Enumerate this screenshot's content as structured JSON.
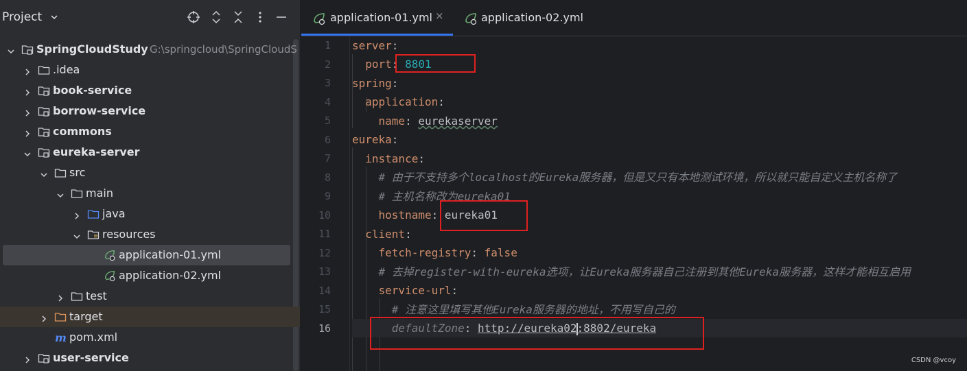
{
  "project_panel": {
    "title": "Project",
    "tree": [
      {
        "label": "SpringCloudStudy",
        "path": "G:\\springcloud\\SpringCloudS",
        "level": 0,
        "arrow": "down",
        "icon": "module-folder",
        "bold": true
      },
      {
        "label": ".idea",
        "level": 1,
        "arrow": "right",
        "icon": "folder"
      },
      {
        "label": "book-service",
        "level": 1,
        "arrow": "right",
        "icon": "module-folder",
        "bold": true
      },
      {
        "label": "borrow-service",
        "level": 1,
        "arrow": "right",
        "icon": "module-folder",
        "bold": true
      },
      {
        "label": "commons",
        "level": 1,
        "arrow": "right",
        "icon": "module-folder",
        "bold": true
      },
      {
        "label": "eureka-server",
        "level": 1,
        "arrow": "down",
        "icon": "module-folder",
        "bold": true
      },
      {
        "label": "src",
        "level": 2,
        "arrow": "down",
        "icon": "folder"
      },
      {
        "label": "main",
        "level": 3,
        "arrow": "down",
        "icon": "folder"
      },
      {
        "label": "java",
        "level": 4,
        "arrow": "right",
        "icon": "source-folder"
      },
      {
        "label": "resources",
        "level": 4,
        "arrow": "down",
        "icon": "resources-folder"
      },
      {
        "label": "application-01.yml",
        "level": 5,
        "arrow": "",
        "icon": "spring-yml",
        "selected": true
      },
      {
        "label": "application-02.yml",
        "level": 5,
        "arrow": "",
        "icon": "spring-yml"
      },
      {
        "label": "test",
        "level": 3,
        "arrow": "right",
        "icon": "folder"
      },
      {
        "label": "target",
        "level": 2,
        "arrow": "right",
        "icon": "excluded-folder",
        "excluded": true
      },
      {
        "label": "pom.xml",
        "level": 2,
        "arrow": "",
        "icon": "maven-file"
      },
      {
        "label": "user-service",
        "level": 1,
        "arrow": "right",
        "icon": "module-folder",
        "bold": true
      }
    ]
  },
  "editor": {
    "tabs": [
      {
        "label": "application-01.yml",
        "active": true,
        "close": "×"
      },
      {
        "label": "application-02.yml",
        "active": false
      }
    ],
    "line_numbers": [
      "1",
      "2",
      "3",
      "4",
      "5",
      "6",
      "7",
      "8",
      "9",
      "10",
      "11",
      "12",
      "13",
      "14",
      "15",
      "16"
    ],
    "current_line": "16",
    "code": {
      "l1_key": "server",
      "l2_key": "port",
      "l2_val": "8801",
      "l3_key": "spring",
      "l4_key": "application",
      "l5_key": "name",
      "l5_val": "eurekaserver",
      "l6_key": "eureka",
      "l7_key": "instance",
      "l8_comment": "# 由于不支持多个localhost的Eureka服务器，但是又只有本地测试环境，所以就只能自定义主机名称了",
      "l9_comment": "# 主机名称改为eureka01",
      "l10_key": "hostname",
      "l10_val": "eureka01",
      "l11_key": "client",
      "l12_key": "fetch-registry",
      "l12_val": "false",
      "l13_comment": "# 去掉register-with-eureka选项，让Eureka服务器自己注册到其他Eureka服务器，这样才能相互启用",
      "l14_key": "service-url",
      "l15_comment": "# 注意这里填写其他Eureka服务器的地址，不用写自己的",
      "l16_key": "defaultZone",
      "l16_val_a": "http://eureka02",
      "l16_val_b": ":8802/eureka"
    }
  },
  "watermark": "CSDN @vcoy",
  "colors": {
    "highlight_box": "#e02020",
    "tab_underline": "#3574f0",
    "keyword": "#cf8e6d",
    "number": "#2aacb8",
    "comment": "#7a7e85"
  }
}
